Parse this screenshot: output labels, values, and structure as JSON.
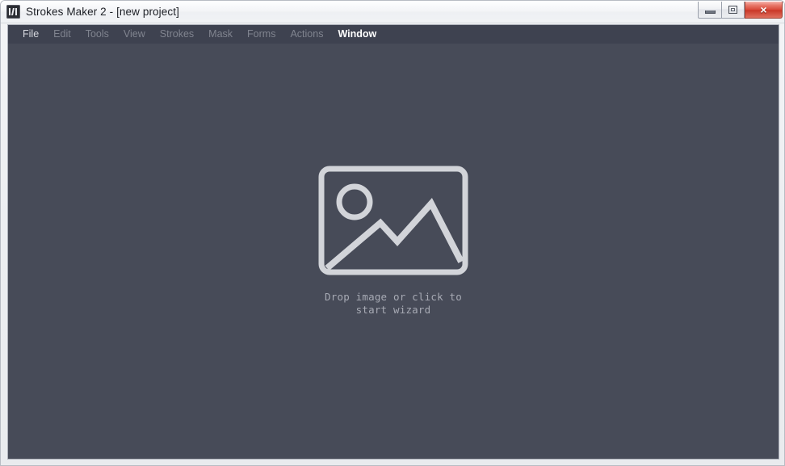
{
  "window": {
    "title": "Strokes Maker 2 - [new project]",
    "app_icon": "app-logo-icon",
    "controls": {
      "minimize_label": "–",
      "maximize_label": "□",
      "close_label": "×",
      "close_color": "#cd3a2a"
    }
  },
  "menu": {
    "items": [
      {
        "label": "File",
        "state": "enabled"
      },
      {
        "label": "Edit",
        "state": "disabled"
      },
      {
        "label": "Tools",
        "state": "disabled"
      },
      {
        "label": "View",
        "state": "disabled"
      },
      {
        "label": "Strokes",
        "state": "disabled"
      },
      {
        "label": "Mask",
        "state": "disabled"
      },
      {
        "label": "Forms",
        "state": "disabled"
      },
      {
        "label": "Actions",
        "state": "disabled"
      },
      {
        "label": "Window",
        "state": "active"
      }
    ]
  },
  "canvas": {
    "background_color": "#474b58",
    "drop_zone": {
      "icon": "image-placeholder-icon",
      "icon_color": "#d2d4d9",
      "hint_line_1": "Drop image or click to",
      "hint_line_2": "start wizard",
      "hint_text": "Drop image or click to\nstart wizard",
      "hint_color": "#a7aab4"
    }
  }
}
